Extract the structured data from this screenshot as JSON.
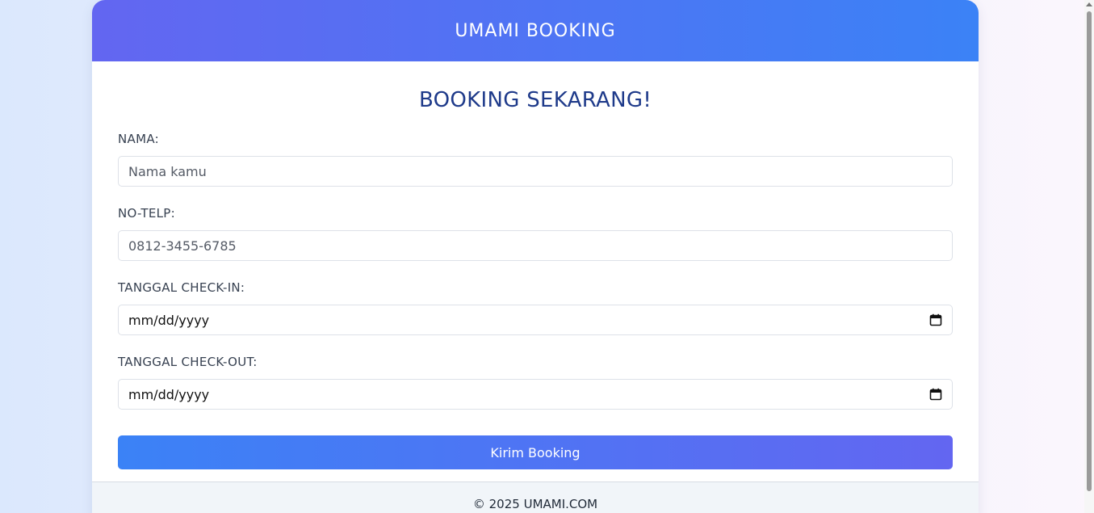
{
  "header": {
    "title": "UMAMI BOOKING"
  },
  "form": {
    "title": "BOOKING SEKARANG!",
    "fields": [
      {
        "label": "NAMA:",
        "placeholder": "Nama kamu",
        "type": "text"
      },
      {
        "label": "NO-TELP:",
        "placeholder": "0812-3455-6785",
        "type": "text"
      },
      {
        "label": "TANGGAL CHECK-IN:",
        "value": "mm/dd/yyyy",
        "type": "date"
      },
      {
        "label": "TANGGAL CHECK-OUT:",
        "value": "mm/dd/yyyy",
        "type": "date"
      }
    ],
    "submit_label": "Kirim Booking"
  },
  "footer": {
    "text": "© 2025 UMAMI.COM"
  },
  "colors": {
    "header_gradient_start": "#6366f1",
    "header_gradient_end": "#3b82f6",
    "title_color": "#1e3a8a"
  },
  "icons": {
    "date_picker": "calendar-icon"
  }
}
